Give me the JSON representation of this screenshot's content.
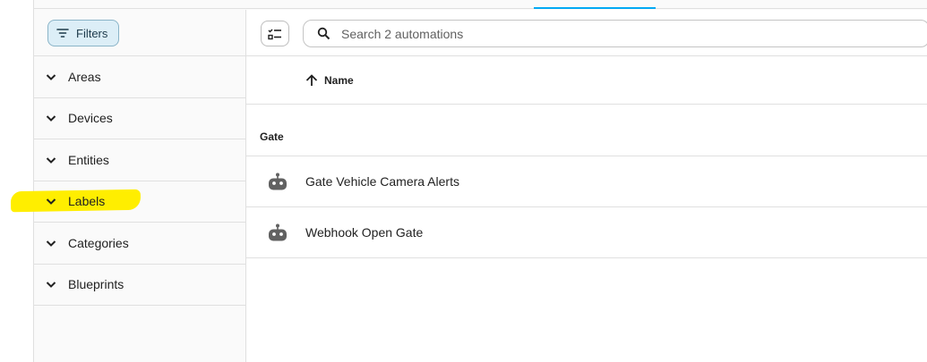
{
  "filter_pane": {
    "filters_label": "Filters",
    "sections": [
      {
        "label": "Areas"
      },
      {
        "label": "Devices"
      },
      {
        "label": "Entities"
      },
      {
        "label": "Labels"
      },
      {
        "label": "Categories"
      },
      {
        "label": "Blueprints"
      }
    ]
  },
  "search": {
    "placeholder": "Search 2 automations",
    "value": ""
  },
  "table": {
    "sort_column": "Name",
    "sort_direction": "ascending",
    "group_label": "Gate",
    "rows": [
      {
        "name": "Gate Vehicle Camera Alerts",
        "icon": "robot-icon"
      },
      {
        "name": "Webhook Open Gate",
        "icon": "robot-icon"
      }
    ]
  },
  "colors": {
    "accent": "#03a9f4",
    "filter_button_bg": "#dceef7",
    "highlight": "#ffee00"
  }
}
